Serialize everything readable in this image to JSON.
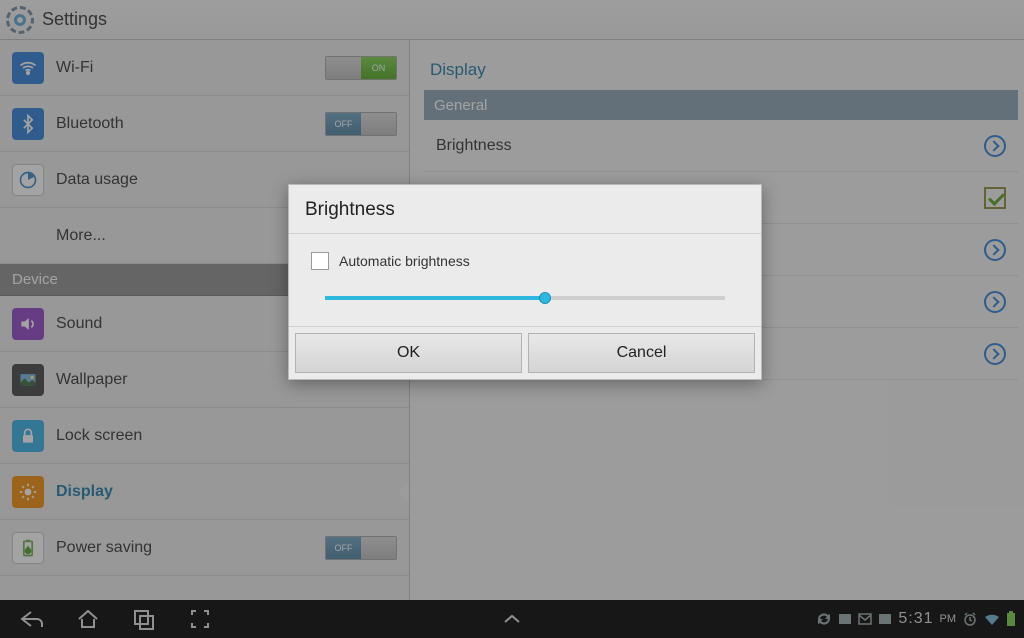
{
  "header": {
    "title": "Settings"
  },
  "sidebar": {
    "items": [
      {
        "label": "Wi-Fi",
        "toggle": "ON"
      },
      {
        "label": "Bluetooth",
        "toggle": "OFF"
      },
      {
        "label": "Data usage"
      },
      {
        "label": "More..."
      }
    ],
    "device_header": "Device",
    "device_items": [
      {
        "label": "Sound"
      },
      {
        "label": "Wallpaper"
      },
      {
        "label": "Lock screen"
      },
      {
        "label": "Display"
      },
      {
        "label": "Power saving",
        "toggle": "OFF"
      }
    ]
  },
  "right": {
    "title": "Display",
    "section": "General",
    "rows": [
      {
        "label": "Brightness",
        "action": "chevron"
      },
      {
        "label": "",
        "action": "check"
      },
      {
        "label": "",
        "action": "chevron"
      },
      {
        "label": "",
        "action": "chevron"
      },
      {
        "label": "",
        "action": "chevron"
      }
    ]
  },
  "dialog": {
    "title": "Brightness",
    "auto_label": "Automatic brightness",
    "auto_checked": false,
    "slider_percent": 55,
    "ok": "OK",
    "cancel": "Cancel"
  },
  "statusbar": {
    "time": "5:31",
    "ampm": "PM"
  }
}
